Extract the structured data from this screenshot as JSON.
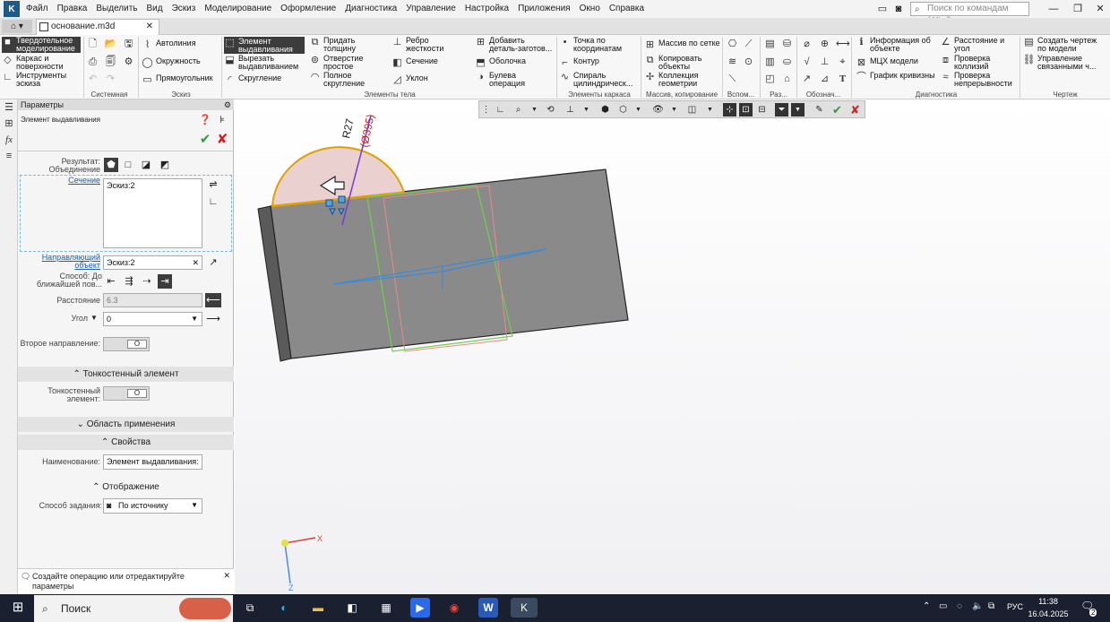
{
  "menu": [
    "Файл",
    "Правка",
    "Выделить",
    "Вид",
    "Эскиз",
    "Моделирование",
    "Оформление",
    "Диагностика",
    "Управление",
    "Настройка",
    "Приложения",
    "Окно",
    "Справка"
  ],
  "search_placeholder": "Поиск по командам (Alt+/)",
  "tab_doc": "основание.m3d",
  "ribbon": {
    "modes": [
      "Твердотельное моделирование",
      "Каркас и поверхности",
      "Инструменты эскиза"
    ],
    "sketch": [
      "Автолиния",
      "Окружность",
      "Прямоугольник"
    ],
    "elements": [
      "Элемент выдавливания",
      "Вырезать выдавливанием",
      "Скругление",
      "Придать толщину",
      "Отверстие простое",
      "Полное скругление",
      "Ребро жесткости",
      "Сечение",
      "Уклон",
      "Добавить деталь-заготов...",
      "Оболочка",
      "Булева операция"
    ],
    "frame": [
      "Точка по координатам",
      "Контур",
      "Спираль цилиндрическ..."
    ],
    "array": [
      "Массив по сетке",
      "Копировать объекты",
      "Коллекция геометрии"
    ],
    "diag": [
      "Информация об объекте",
      "МЦХ модели",
      "График кривизны",
      "Расстояние и угол",
      "Проверка коллизий",
      "Проверка непрерывности"
    ],
    "drawing": [
      "Создать чертеж по модели",
      "Управление связанными ч..."
    ],
    "groups": [
      "Системная",
      "Эскиз",
      "Элементы тела",
      "Элементы каркаса",
      "Массив, копирование",
      "Вспом...",
      "Раз...",
      "Обознач...",
      "Диагностика",
      "Чертеж"
    ]
  },
  "panel": {
    "title": "Параметры",
    "subtitle": "Элемент выдавливания",
    "result_label": "Результат: Объединение",
    "section_label": "Сечение",
    "section_value": "Эскиз:2",
    "guide_label": "Направляющий объект",
    "guide_value": "Эскиз:2",
    "method_label": "Способ: До ближайшей пов...",
    "distance_label": "Расстояние",
    "distance_value": "6.3",
    "angle_label": "Угол",
    "angle_value": "0",
    "second_dir_label": "Второе направление:",
    "thinwall_section": "Тонкостенный элемент",
    "thinwall_label": "Тонкостенный элемент:",
    "scope_section": "Область применения",
    "props_section": "Свойства",
    "name_label": "Наименование:",
    "name_value": "Элемент выдавливания:",
    "display_section": "Отображение",
    "method2_label": "Способ задания:",
    "method2_value": "По источнику"
  },
  "status_text": "Создайте операцию или отредактируйте параметры",
  "viewport": {
    "dim1": "R27",
    "dim2": "(Ø395)",
    "axis_x": "X",
    "axis_z": "Z"
  },
  "taskbar": {
    "search": "Поиск",
    "lang": "РУС",
    "time": "11:38",
    "date": "16.04.2025",
    "notif": "2"
  }
}
